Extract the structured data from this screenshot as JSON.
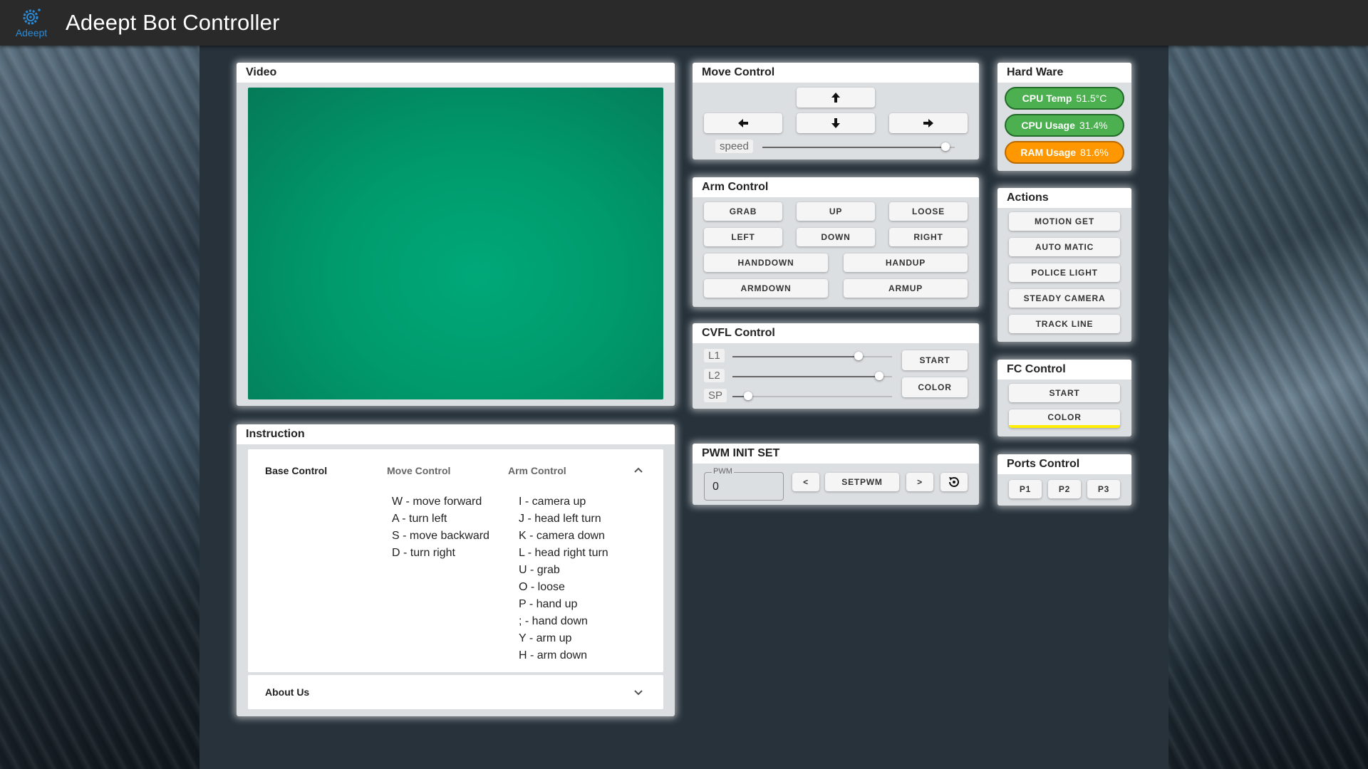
{
  "header": {
    "logo_text": "Adeept",
    "title": "Adeept Bot Controller"
  },
  "video": {
    "title": "Video"
  },
  "move_control": {
    "title": "Move Control",
    "speed_label": "speed",
    "speed_value": 0.95
  },
  "arm_control": {
    "title": "Arm Control",
    "buttons": [
      "GRAB",
      "UP",
      "LOOSE",
      "LEFT",
      "DOWN",
      "RIGHT",
      "HANDDOWN",
      "HANDUP",
      "ARMDOWN",
      "ARMUP"
    ]
  },
  "cvfl_control": {
    "title": "CVFL Control",
    "sliders": [
      {
        "label": "L1",
        "value": 0.79
      },
      {
        "label": "L2",
        "value": 0.92
      },
      {
        "label": "SP",
        "value": 0.1
      }
    ],
    "start_label": "START",
    "color_label": "COLOR"
  },
  "pwm": {
    "title": "PWM INIT SET",
    "field_label": "PWM",
    "field_value": "0",
    "prev_label": "<",
    "set_label": "SETPWM",
    "next_label": ">"
  },
  "hardware": {
    "title": "Hard Ware",
    "cpu_temp": {
      "label": "CPU Temp",
      "value": "51.5°C",
      "color": "#4caf50"
    },
    "cpu_usage": {
      "label": "CPU Usage",
      "value": "31.4%",
      "color": "#4caf50"
    },
    "ram_usage": {
      "label": "RAM Usage",
      "value": "81.6%",
      "color": "#ff9800"
    }
  },
  "actions": {
    "title": "Actions",
    "buttons": [
      "MOTION GET",
      "AUTO MATIC",
      "POLICE LIGHT",
      "STEADY CAMERA",
      "TRACK LINE"
    ]
  },
  "fc_control": {
    "title": "FC Control",
    "start_label": "START",
    "color_label": "COLOR",
    "color_bar": "#ffee00"
  },
  "ports_control": {
    "title": "Ports Control",
    "buttons": [
      "P1",
      "P2",
      "P3"
    ]
  },
  "instruction": {
    "title": "Instruction",
    "tabs": [
      "Base Control",
      "Move Control",
      "Arm Control"
    ],
    "move_list": [
      "W - move forward",
      "A - turn left",
      "S - move backward",
      "D - turn right"
    ],
    "arm_list": [
      "I - camera up",
      "J - head left turn",
      "K - camera down",
      "L - head right turn",
      "U - grab",
      "O - loose",
      "P - hand up",
      "; - hand down",
      "Y - arm up",
      "H - arm down"
    ],
    "about_label": "About Us"
  },
  "colors": {
    "video_bg": "#00a070",
    "accent": "#2a8bd8"
  }
}
